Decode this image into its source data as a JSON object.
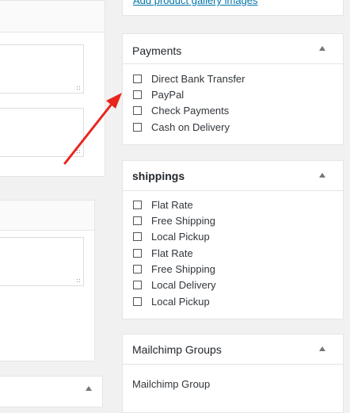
{
  "gallery_link": "Add product gallery images",
  "payments": {
    "title": "Payments",
    "options": [
      "Direct Bank Transfer",
      "PayPal",
      "Check Payments",
      "Cash on Delivery"
    ]
  },
  "shippings": {
    "title": "shippings",
    "options": [
      "Flat Rate",
      "Free Shipping",
      "Local Pickup",
      "Flat Rate",
      "Free Shipping",
      "Local Delivery",
      "Local Pickup"
    ]
  },
  "mailchimp": {
    "title": "Mailchimp Groups",
    "group_label": "Mailchimp Group"
  },
  "colors": {
    "background": "#f1f1f1",
    "link": "#0073aa",
    "arrow": "#e8251d"
  }
}
